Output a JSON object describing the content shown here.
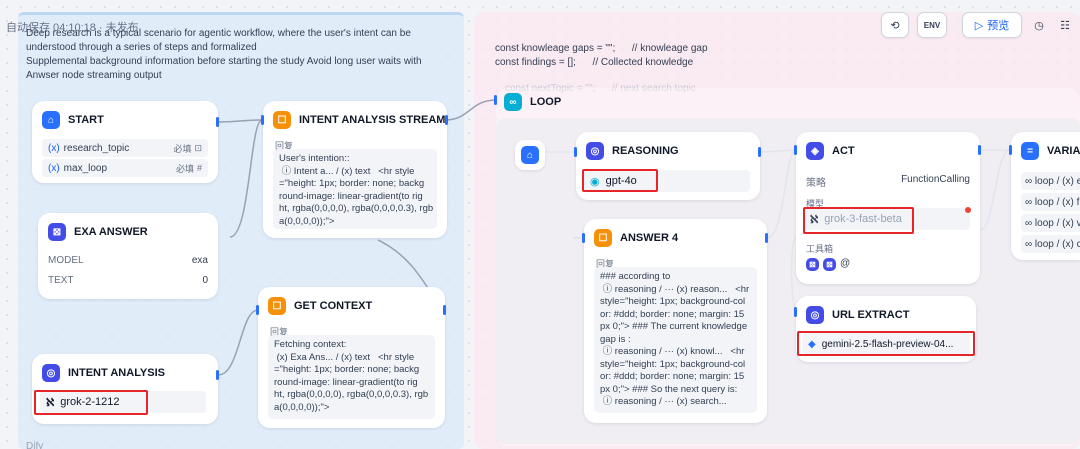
{
  "autosave": "自动保存 04:10:18 · 未发布",
  "notes": {
    "left": "Deep research is a typical scenario for agentic workflow, where the user's intent can be\nunderstood through a series of steps and formalized\nSupplemental background information before starting the study Avoid long user waits with\nAnwser node streaming output",
    "right": "const knowleage gaps = \"\";      // knowleage gap\nconst findings = [];      // Collected knowledge",
    "faded": "const nextTopic = \"\";      // next search topic",
    "dify": "Dify"
  },
  "toolbar": {
    "preview_label": "预览",
    "env_label": "ENV"
  },
  "nodes": {
    "start": {
      "title": "START",
      "vars": [
        {
          "name": "research_topic",
          "tag": "必填"
        },
        {
          "name": "max_loop",
          "tag": "必填"
        }
      ]
    },
    "exa_answer": {
      "title": "EXA ANSWER",
      "rows": [
        {
          "k": "MODEL",
          "v": "exa"
        },
        {
          "k": "TEXT",
          "v": "0"
        }
      ]
    },
    "intent_analysis": {
      "title": "INTENT ANALYSIS",
      "model": "grok-2-1212"
    },
    "intent_stream": {
      "title": "INTENT ANALYSIS STREAM",
      "label": "回复",
      "body": "User's intention::\n ⓘ Intent a... / (x) text   <hr style\n=\"height: 1px; border: none; backg\nround-image: linear-gradient(to rig\nht, rgba(0,0,0,0), rgba(0,0,0,0.3), rgb\na(0,0,0,0));\">"
    },
    "get_context": {
      "title": "GET CONTEXT",
      "label": "回复",
      "body": "Fetching context:\n (x) Exa Ans... / (x) text   <hr style\n=\"height: 1px; border: none; backg\nround-image: linear-gradient(to rig\nht, rgba(0,0,0,0), rgba(0,0,0,0.3), rgb\na(0,0,0,0));\">"
    },
    "loop": {
      "title": "LOOP"
    },
    "reasoning": {
      "title": "REASONING",
      "model": "gpt-4o"
    },
    "answer4": {
      "title": "ANSWER 4",
      "label": "回复",
      "body": "### according to\n ⓘ reasoning / ··· (x) reason...   <hr\nstyle=\"height: 1px; background-col\nor: #ddd; border: none; margin: 15\npx 0;\"> ### The current knowledge\ngap is :\n ⓘ reasoning / ··· (x) knowl...   <hr\nstyle=\"height: 1px; background-col\nor: #ddd; border: none; margin: 15\npx 0;\"> ### So the next query is:\n ⓘ reasoning / ··· (x) search..."
    },
    "act": {
      "title": "ACT",
      "strategy_label": "策略",
      "strategy_value": "FunctionCalling",
      "model_label": "模型",
      "model": "grok-3-fast-beta",
      "tools_label": "工具箱"
    },
    "url_extract": {
      "title": "URL EXTRACT",
      "model": "gemini-2.5-flash-preview-04..."
    },
    "variable": {
      "title": "VARIAB",
      "items": [
        "∞ loop / (x) e",
        "∞ loop / (x) f",
        "∞ loop / (x) v",
        "∞ loop / (x) c"
      ]
    }
  }
}
